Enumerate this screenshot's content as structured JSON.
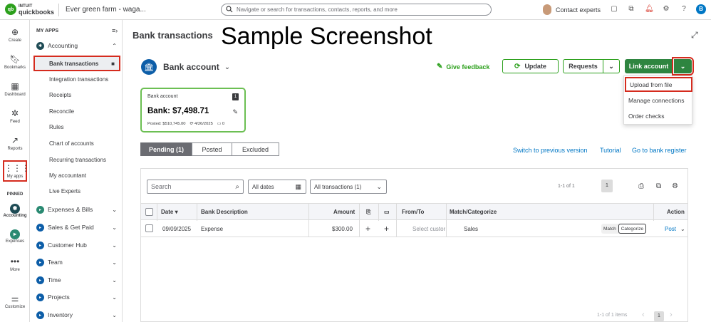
{
  "topbar": {
    "brand_top": "INTUIT",
    "brand_bottom": "quickbooks",
    "company": "Ever green farm - waga...",
    "search_placeholder": "Navigate or search for transactions, contacts, reports, and more",
    "contact_experts": "Contact experts",
    "profile_initial": "B"
  },
  "rail": {
    "create": "Create",
    "bookmarks": "Bookmarks",
    "dashboard": "Dashboard",
    "feed": "Feed",
    "reports": "Reports",
    "my_apps": "My apps",
    "pinned": "PINNED",
    "accounting": "Accounting",
    "expenses": "Expenses",
    "more": "More",
    "customize": "Customize"
  },
  "apps": {
    "heading": "MY APPS",
    "accounting": "Accounting",
    "items": [
      "Bank transactions",
      "Integration transactions",
      "Receipts",
      "Reconcile",
      "Rules",
      "Chart of accounts",
      "Recurring transactions",
      "My accountant",
      "Live Experts"
    ],
    "groups": [
      "Expenses & Bills",
      "Sales & Get Paid",
      "Customer Hub",
      "Team",
      "Time",
      "Projects",
      "Inventory"
    ]
  },
  "main": {
    "title": "Bank transactions",
    "watermark": "Sample Screenshot",
    "account_selector": "Bank account",
    "give_feedback": "Give feedback",
    "update": "Update",
    "requests": "Requests",
    "link_account": "Link account",
    "dropdown": [
      "Upload from file",
      "Manage connections",
      "Order checks"
    ],
    "card": {
      "label": "Bank account",
      "count": "1",
      "balance": "Bank: $7,498.71",
      "posted": "Posted: $510,745.00",
      "date": "4/26/2025",
      "comments": "0"
    },
    "tabs": [
      "Pending (1)",
      "Posted",
      "Excluded"
    ],
    "links": [
      "Switch to previous version",
      "Tutorial",
      "Go to bank register"
    ]
  },
  "table": {
    "search_placeholder": "Search",
    "dates_filter": "All dates",
    "tx_filter": "All transactions (1)",
    "pager_top": "1-1 of 1",
    "page": "1",
    "headers": {
      "date": "Date",
      "description": "Bank Description",
      "amount": "Amount",
      "from_to": "From/To",
      "match": "Match/Categorize",
      "action": "Action"
    },
    "rows": [
      {
        "date": "09/09/2025",
        "description": "Expense",
        "amount": "$300.00",
        "from_to": "Select custor",
        "category": "Sales",
        "match": "Match",
        "categorize": "Categorize",
        "action": "Post"
      }
    ],
    "pager_bottom": "1-1 of 1 items"
  }
}
